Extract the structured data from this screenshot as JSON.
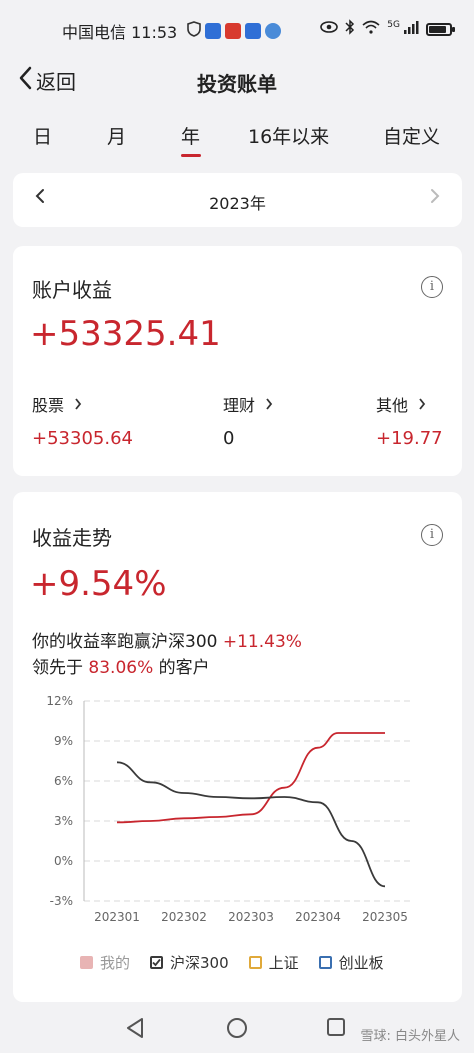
{
  "status_bar": {
    "carrier_time": "中国电信 11:53",
    "network": "5G"
  },
  "header": {
    "back_label": "返回",
    "title": "投资账单"
  },
  "tabs": [
    "日",
    "月",
    "年",
    "16年以来",
    "自定义"
  ],
  "active_tab": "年",
  "year_selector": {
    "label": "2023年"
  },
  "account": {
    "title": "账户收益",
    "total": "+53325.41",
    "items": [
      {
        "label": "股票",
        "value": "+53305.64"
      },
      {
        "label": "理财",
        "value": "0"
      },
      {
        "label": "其他",
        "value": "+19.77"
      }
    ]
  },
  "trend": {
    "title": "收益走势",
    "rate": "+9.54%",
    "desc1_prefix": "你的收益率跑赢沪深300",
    "desc1_value": "+11.43%",
    "desc2_prefix": "领先于",
    "desc2_value": "83.06%",
    "desc2_suffix": "的客户"
  },
  "colors": {
    "red": "#c8262e",
    "dark_line": "#3a3a3a",
    "yellow": "#e0a93a",
    "blue": "#3a6fb0"
  },
  "chart_data": {
    "type": "line",
    "x": [
      "202301",
      "202302",
      "202303",
      "202304",
      "202305"
    ],
    "y_ticks": [
      "12%",
      "9%",
      "6%",
      "3%",
      "0%",
      "-3%"
    ],
    "ylim": [
      -3,
      12
    ],
    "series": [
      {
        "name": "我的",
        "color": "#c8262e",
        "points": [
          [
            0,
            2.9
          ],
          [
            0.5,
            3.0
          ],
          [
            1,
            3.2
          ],
          [
            1.5,
            3.3
          ],
          [
            2,
            3.5
          ],
          [
            2.5,
            5.5
          ],
          [
            3,
            8.5
          ],
          [
            3.3,
            9.6
          ],
          [
            4,
            9.6
          ]
        ]
      },
      {
        "name": "沪深300",
        "color": "#3a3a3a",
        "points": [
          [
            0,
            7.4
          ],
          [
            0.5,
            5.9
          ],
          [
            1,
            5.1
          ],
          [
            1.5,
            4.8
          ],
          [
            2,
            4.7
          ],
          [
            2.5,
            4.8
          ],
          [
            3,
            4.4
          ],
          [
            3.5,
            1.5
          ],
          [
            4,
            -1.9
          ]
        ]
      }
    ],
    "legend": [
      {
        "label": "我的",
        "color": "#e8b4b4",
        "checked": true
      },
      {
        "label": "沪深300",
        "color": "#3a3a3a",
        "checked": true
      },
      {
        "label": "上证",
        "color": "#e0a93a",
        "checked": false
      },
      {
        "label": "创业板",
        "color": "#3a6fb0",
        "checked": false
      }
    ],
    "grid": true,
    "legend_position": "bottom"
  },
  "watermark": "雪球: 白头外星人"
}
